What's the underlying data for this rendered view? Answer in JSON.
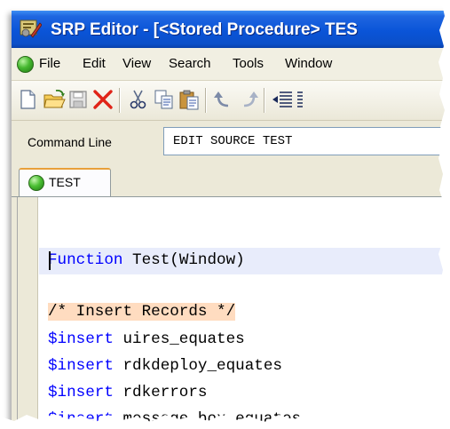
{
  "window": {
    "title": "SRP Editor - [<Stored Procedure> TES",
    "app_icon": "srp-app-icon"
  },
  "menu": {
    "items": [
      "File",
      "Edit",
      "View",
      "Search",
      "Tools",
      "Window"
    ]
  },
  "toolbar": {
    "icons": [
      "new-file-icon",
      "open-folder-icon",
      "save-icon",
      "delete-icon",
      "cut-icon",
      "copy-icon",
      "paste-icon",
      "undo-icon",
      "redo-icon",
      "outdent-icon",
      "indent-icon"
    ]
  },
  "command_line": {
    "label": "Command Line",
    "value": "EDIT SOURCE TEST"
  },
  "tabs": [
    {
      "label": "TEST",
      "active": true
    }
  ],
  "editor": {
    "lines": {
      "l1_kw": "Function",
      "l1_rest": " Test(Window)",
      "l3_comment": "/* Insert Records */",
      "l4_kw": "$insert",
      "l4_rest": " uires_equates",
      "l5_kw": "$insert",
      "l5_rest": " rdkdeploy_equates",
      "l6_kw": "$insert",
      "l6_rest": " rdkerrors",
      "l7_kw": "$insert",
      "l7_rest": " message_box_equates"
    }
  },
  "colors": {
    "titlebar": "#0a54d8",
    "keyword": "#0000ff",
    "comment_bg": "#ffdcc0",
    "current_line": "#e8ecfb",
    "tab_accent": "#e8a03a"
  }
}
